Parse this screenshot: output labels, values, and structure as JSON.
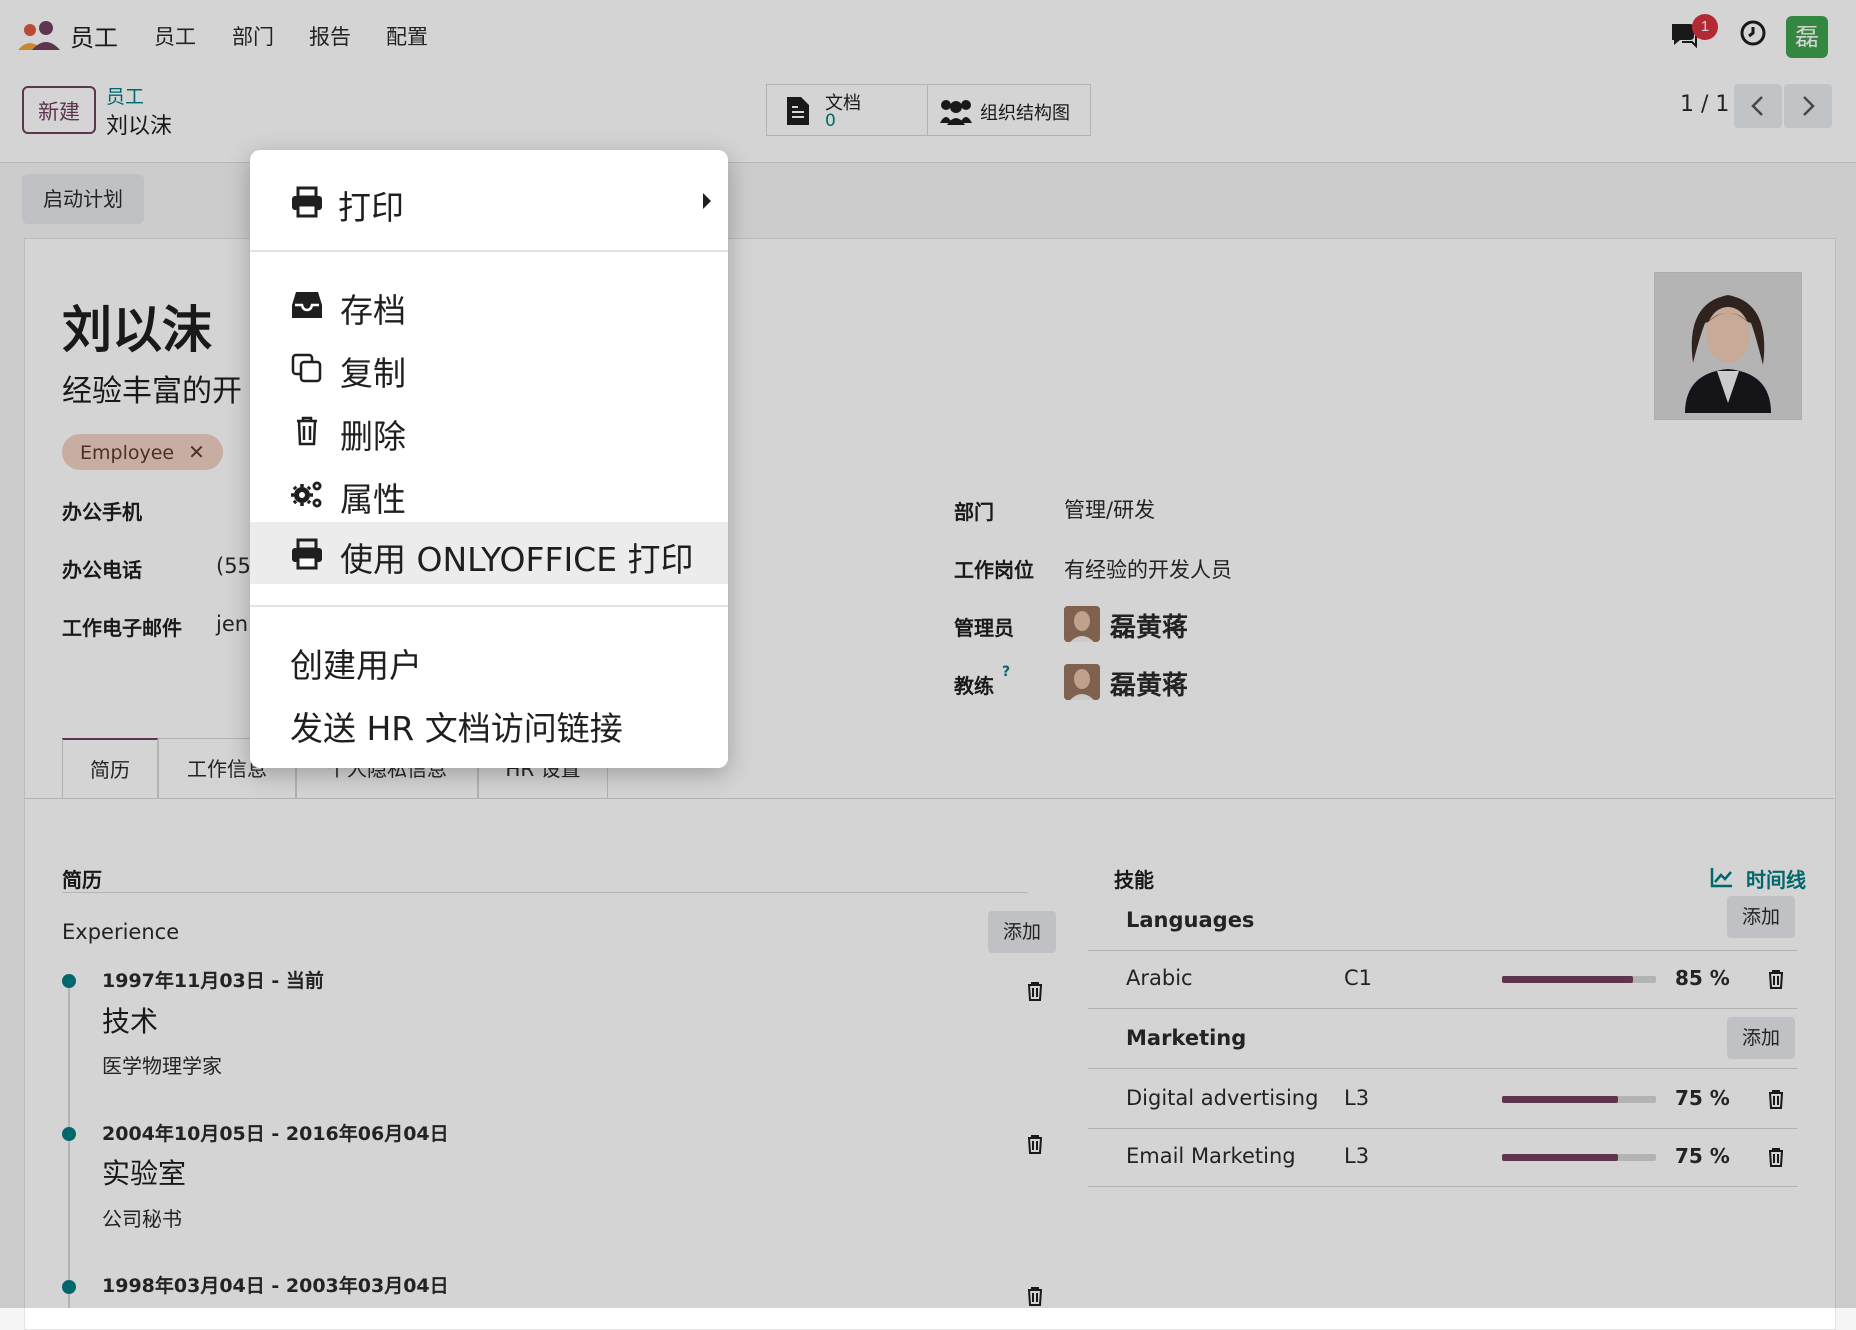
{
  "navbar": {
    "app_name": "员工",
    "menus": [
      "员工",
      "部门",
      "报告",
      "配置"
    ],
    "chat_badge": "1",
    "user_avatar_letter": "磊"
  },
  "control": {
    "new_label": "新建",
    "breadcrumb_parent": "员工",
    "breadcrumb_current": "刘以沫",
    "smart_docs_label": "文档",
    "smart_docs_count": "0",
    "smart_org_label": "组织结构图",
    "pager": "1 / 1"
  },
  "status": {
    "plan_button": "启动计划"
  },
  "employee": {
    "name": "刘以沫",
    "job_title": "经验丰富的开",
    "tag": "Employee",
    "fields_left": [
      {
        "label": "办公手机",
        "value": ""
      },
      {
        "label": "办公电话",
        "value": "(55"
      },
      {
        "label": "工作电子邮件",
        "value": "jenn"
      }
    ],
    "fields_right": {
      "department_label": "部门",
      "department_value": "管理/研发",
      "position_label": "工作岗位",
      "position_value": "有经验的开发人员",
      "manager_label": "管理员",
      "manager_value": "磊黄蒋",
      "coach_label": "教练",
      "coach_hint": "?",
      "coach_value": "磊黄蒋"
    }
  },
  "tabs": [
    "简历",
    "工作信息",
    "个人隐私信息",
    "HR 设置"
  ],
  "resume": {
    "title": "简历",
    "group": "Experience",
    "add_label": "添加",
    "entries": [
      {
        "date": "1997年11月03日 - 当前",
        "title": "技术",
        "desc": "医学物理学家"
      },
      {
        "date": "2004年10月05日 - 2016年06月04日",
        "title": "实验室",
        "desc": "公司秘书"
      },
      {
        "date": "1998年03月04日 - 2003年03月04日",
        "title": "",
        "desc": ""
      }
    ]
  },
  "skills": {
    "title": "技能",
    "timeline_label": "时间线",
    "add_label": "添加",
    "groups": [
      {
        "name": "Languages",
        "items": [
          {
            "name": "Arabic",
            "level": "C1",
            "progress": 85,
            "pct": "85 %"
          }
        ]
      },
      {
        "name": "Marketing",
        "items": [
          {
            "name": "Digital advertising",
            "level": "L3",
            "progress": 75,
            "pct": "75 %"
          },
          {
            "name": "Email Marketing",
            "level": "L3",
            "progress": 75,
            "pct": "75 %"
          }
        ]
      }
    ]
  },
  "dropdown": {
    "print": "打印",
    "archive": "存档",
    "duplicate": "复制",
    "delete": "删除",
    "properties": "属性",
    "onlyoffice_print": "使用 ONLYOFFICE 打印",
    "create_user": "创建用户",
    "send_hr_link": "发送 HR 文档访问链接"
  },
  "colors": {
    "brand": "#71405f",
    "accent": "#017e84",
    "badge": "#d9333f"
  }
}
